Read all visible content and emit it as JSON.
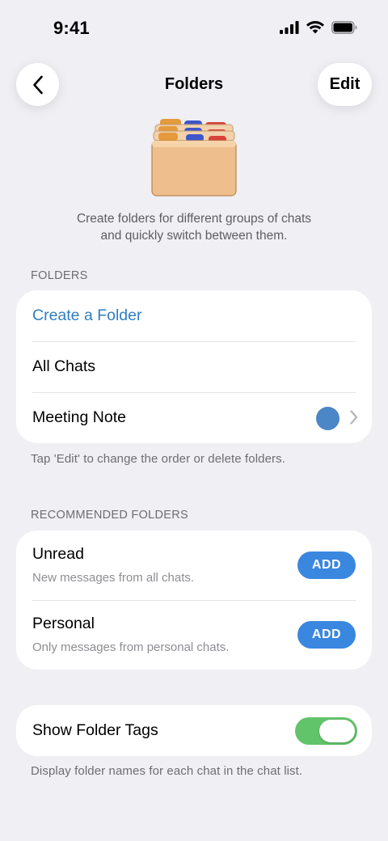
{
  "status_bar": {
    "time": "9:41"
  },
  "nav": {
    "title": "Folders",
    "edit_label": "Edit",
    "back_icon": "chevron-left-icon"
  },
  "hero": {
    "icon": "folders-illustration-icon",
    "description_line1": "Create folders for different groups of chats",
    "description_line2": "and quickly switch between them."
  },
  "folders_section": {
    "header": "FOLDERS",
    "create_label": "Create a Folder",
    "items": [
      {
        "label": "All Chats"
      },
      {
        "label": "Meeting Note",
        "color": "#4b86c7"
      }
    ],
    "footer": "Tap 'Edit' to change the order or delete folders."
  },
  "recommended_section": {
    "header": "RECOMMENDED FOLDERS",
    "items": [
      {
        "title": "Unread",
        "subtitle": "New messages from all chats.",
        "button": "ADD"
      },
      {
        "title": "Personal",
        "subtitle": "Only messages from personal chats.",
        "button": "ADD"
      }
    ]
  },
  "tags_section": {
    "label": "Show Folder Tags",
    "enabled": true,
    "footer": "Display folder names for each chat in the chat list."
  },
  "colors": {
    "accent": "#2f7ec1",
    "add_button": "#3a87e0",
    "toggle_on": "#62c46a",
    "background": "#efeff4"
  }
}
